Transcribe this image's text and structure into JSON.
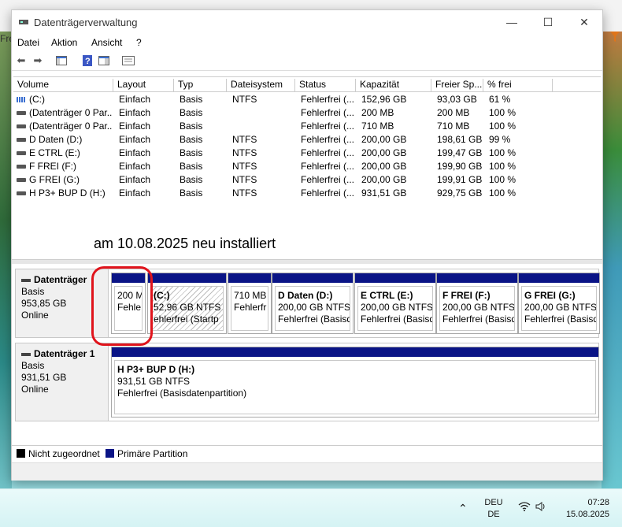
{
  "window": {
    "title": "Datenträgerverwaltung"
  },
  "menu": [
    "Datei",
    "Aktion",
    "Ansicht",
    "?"
  ],
  "behind": {
    "left_text": "Fre",
    "filter_icon": "filter-icon"
  },
  "list": {
    "columns": [
      "Volume",
      "Layout",
      "Typ",
      "Dateisystem",
      "Status",
      "Kapazität",
      "Freier Sp...",
      "% frei"
    ],
    "rows": [
      {
        "volume": "(C:)",
        "layout": "Einfach",
        "typ": "Basis",
        "fs": "NTFS",
        "status": "Fehlerfrei (...",
        "cap": "152,96 GB",
        "free": "93,03 GB",
        "pct": "61 %",
        "sys": true
      },
      {
        "volume": "(Datenträger 0 Par...",
        "layout": "Einfach",
        "typ": "Basis",
        "fs": "",
        "status": "Fehlerfrei (...",
        "cap": "200 MB",
        "free": "200 MB",
        "pct": "100 %"
      },
      {
        "volume": "(Datenträger 0 Par...",
        "layout": "Einfach",
        "typ": "Basis",
        "fs": "",
        "status": "Fehlerfrei (...",
        "cap": "710 MB",
        "free": "710 MB",
        "pct": "100 %"
      },
      {
        "volume": "D Daten (D:)",
        "layout": "Einfach",
        "typ": "Basis",
        "fs": "NTFS",
        "status": "Fehlerfrei (...",
        "cap": "200,00 GB",
        "free": "198,61 GB",
        "pct": "99 %"
      },
      {
        "volume": "E CTRL (E:)",
        "layout": "Einfach",
        "typ": "Basis",
        "fs": "NTFS",
        "status": "Fehlerfrei (...",
        "cap": "200,00 GB",
        "free": "199,47 GB",
        "pct": "100 %"
      },
      {
        "volume": "F FREI (F:)",
        "layout": "Einfach",
        "typ": "Basis",
        "fs": "NTFS",
        "status": "Fehlerfrei (...",
        "cap": "200,00 GB",
        "free": "199,90 GB",
        "pct": "100 %"
      },
      {
        "volume": "G FREI (G:)",
        "layout": "Einfach",
        "typ": "Basis",
        "fs": "NTFS",
        "status": "Fehlerfrei (...",
        "cap": "200,00 GB",
        "free": "199,91 GB",
        "pct": "100 %"
      },
      {
        "volume": "H P3+ BUP D (H:)",
        "layout": "Einfach",
        "typ": "Basis",
        "fs": "NTFS",
        "status": "Fehlerfrei (...",
        "cap": "931,51 GB",
        "free": "929,75 GB",
        "pct": "100 %"
      }
    ]
  },
  "note": "am 10.08.2025 neu installiert",
  "disk0": {
    "name": "Datenträger",
    "type": "Basis",
    "size": "953,85 GB",
    "state": "Online",
    "partitions": [
      {
        "name": "",
        "size": "200 M",
        "status": "Fehle"
      },
      {
        "name": "(C:)",
        "size": "52,96 GB NTFS",
        "status": "ehlerfrei (Startp"
      },
      {
        "name": "",
        "size": "710 MB",
        "status": "Fehlerfr"
      },
      {
        "name": "D Daten  (D:)",
        "size": "200,00 GB NTFS",
        "status": "Fehlerfrei (Basisd"
      },
      {
        "name": "E CTRL  (E:)",
        "size": "200,00 GB NTFS",
        "status": "Fehlerfrei (Basisd"
      },
      {
        "name": "F FREI  (F:)",
        "size": "200,00 GB NTFS",
        "status": "Fehlerfrei (Basisd"
      },
      {
        "name": "G FREI  (G:)",
        "size": "200,00 GB NTFS",
        "status": "Fehlerfrei (Basisd"
      }
    ]
  },
  "disk1": {
    "name": "Datenträger 1",
    "type": "Basis",
    "size": "931,51 GB",
    "state": "Online",
    "partitions": [
      {
        "name": "H P3+ BUP D  (H:)",
        "size": "931,51 GB NTFS",
        "status": "Fehlerfrei (Basisdatenpartition)"
      }
    ]
  },
  "legend": {
    "unallocated": "Nicht zugeordnet",
    "primary": "Primäre Partition"
  },
  "taskbar": {
    "lang1": "DEU",
    "lang2": "DE",
    "time": "07:28",
    "date": "15.08.2025"
  },
  "colors": {
    "partition_bar": "#0a1486",
    "highlight": "#e0141c"
  }
}
